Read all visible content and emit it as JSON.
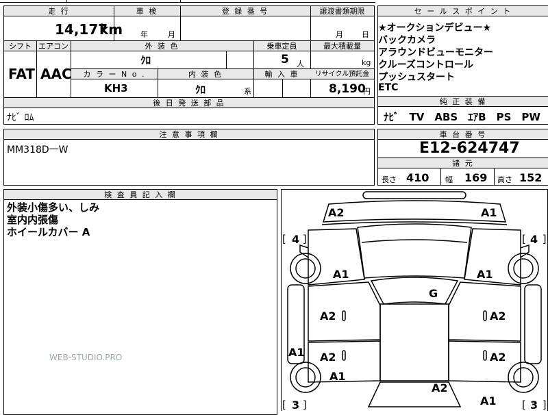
{
  "mileage": {
    "label": "走 行",
    "value": "14,177",
    "unit": "km"
  },
  "inspection": {
    "label": "車 検",
    "year": "年",
    "month": "月"
  },
  "registration": {
    "label": "登 録 番 号",
    "value": ""
  },
  "transfer_deadline": {
    "label": "譲渡書類期限",
    "month": "月",
    "day": "日"
  },
  "shift": {
    "label": "シフト",
    "value": "FAT"
  },
  "aircon": {
    "label": "エアコン",
    "value": "AAC"
  },
  "exterior_color": {
    "label": "外 装 色",
    "value": "ｸﾛ"
  },
  "capacity": {
    "label": "乗車定員",
    "value": "5",
    "unit": "人"
  },
  "max_load": {
    "label": "最大積載量",
    "value": "",
    "unit": "kg"
  },
  "color_no": {
    "label": "カ ラ ー N o .",
    "value": "KH3"
  },
  "interior_color": {
    "label": "内 装 色",
    "value": "ｸﾛ",
    "suffix": "系"
  },
  "import": {
    "label": "輸 入 車",
    "value": ""
  },
  "recycle": {
    "label": "リサイクル預託金",
    "value": "8,190",
    "unit": "円"
  },
  "later_parts": {
    "label": "後 日 発 送 部 品",
    "value": "ﾅﾋﾞ ﾛﾑ"
  },
  "notes": {
    "label": "注 意 事 項 欄",
    "value": "MM318D一W"
  },
  "sales_points": {
    "label": "セ ー ル ス ポ イ ン ト",
    "items": [
      "★オークションデビュー★",
      "バックカメラ",
      "アラウンドビューモニター",
      "クルーズコントロール",
      "プッシュスタート",
      "ETC"
    ]
  },
  "standard_equipment": {
    "label": "純 正 装 備",
    "value": "ﾅﾋﾞ　TV　ABS　ｴｱB　PS　PW"
  },
  "chassis_number": {
    "label": "車 台 番 号",
    "value": "E12-624747"
  },
  "specs": {
    "label": "諸 元",
    "length_label": "長さ",
    "length": "410",
    "width_label": "幅",
    "width": "169",
    "height_label": "高さ",
    "height": "152"
  },
  "inspector": {
    "label": "検 査 員 記 入 欄",
    "lines": [
      "外装小傷多い、しみ",
      "室内内張傷",
      "ホイールカバー A"
    ]
  },
  "watermark": "WEB-STUDIO.PRO",
  "top_fragment": "",
  "diagram": {
    "marks": {
      "front_left": "A2",
      "front_right": "A1",
      "tire_fl": "4",
      "tire_fr": "4",
      "tire_rl": "3",
      "tire_rr": "3",
      "fender_fl": "A1",
      "fender_fr": "A1",
      "glass": "G",
      "door_fl": "A2",
      "door_fr": "A2",
      "sill_l": "A1",
      "door_rl": "A2",
      "door_rr": "A2",
      "fender_rl": "A1",
      "rear_center": "A2",
      "rear_right": "A1"
    }
  }
}
